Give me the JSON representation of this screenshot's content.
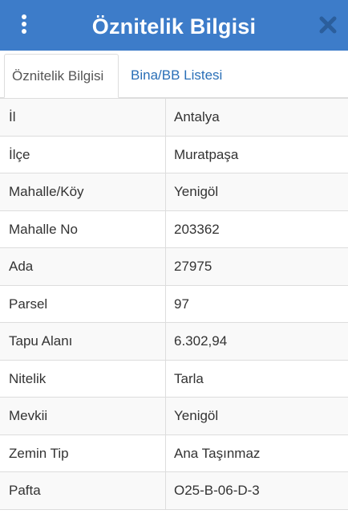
{
  "header": {
    "title": "Öznitelik Bilgisi",
    "menu_icon": "vertical-dots-icon",
    "close_icon": "close-icon",
    "accent_color": "#3d7cc9"
  },
  "tabs": [
    {
      "label": "Öznitelik Bilgisi",
      "active": true
    },
    {
      "label": "Bina/BB Listesi",
      "active": false
    }
  ],
  "attributes": [
    {
      "key": "İl",
      "value": "Antalya"
    },
    {
      "key": "İlçe",
      "value": "Muratpaşa"
    },
    {
      "key": "Mahalle/Köy",
      "value": "Yenigöl"
    },
    {
      "key": "Mahalle No",
      "value": "203362"
    },
    {
      "key": "Ada",
      "value": "27975"
    },
    {
      "key": "Parsel",
      "value": "97"
    },
    {
      "key": "Tapu Alanı",
      "value": "6.302,94"
    },
    {
      "key": "Nitelik",
      "value": "Tarla"
    },
    {
      "key": "Mevkii",
      "value": "Yenigöl"
    },
    {
      "key": "Zemin Tip",
      "value": "Ana Taşınmaz"
    },
    {
      "key": "Pafta",
      "value": "O25-B-06-D-3"
    }
  ]
}
